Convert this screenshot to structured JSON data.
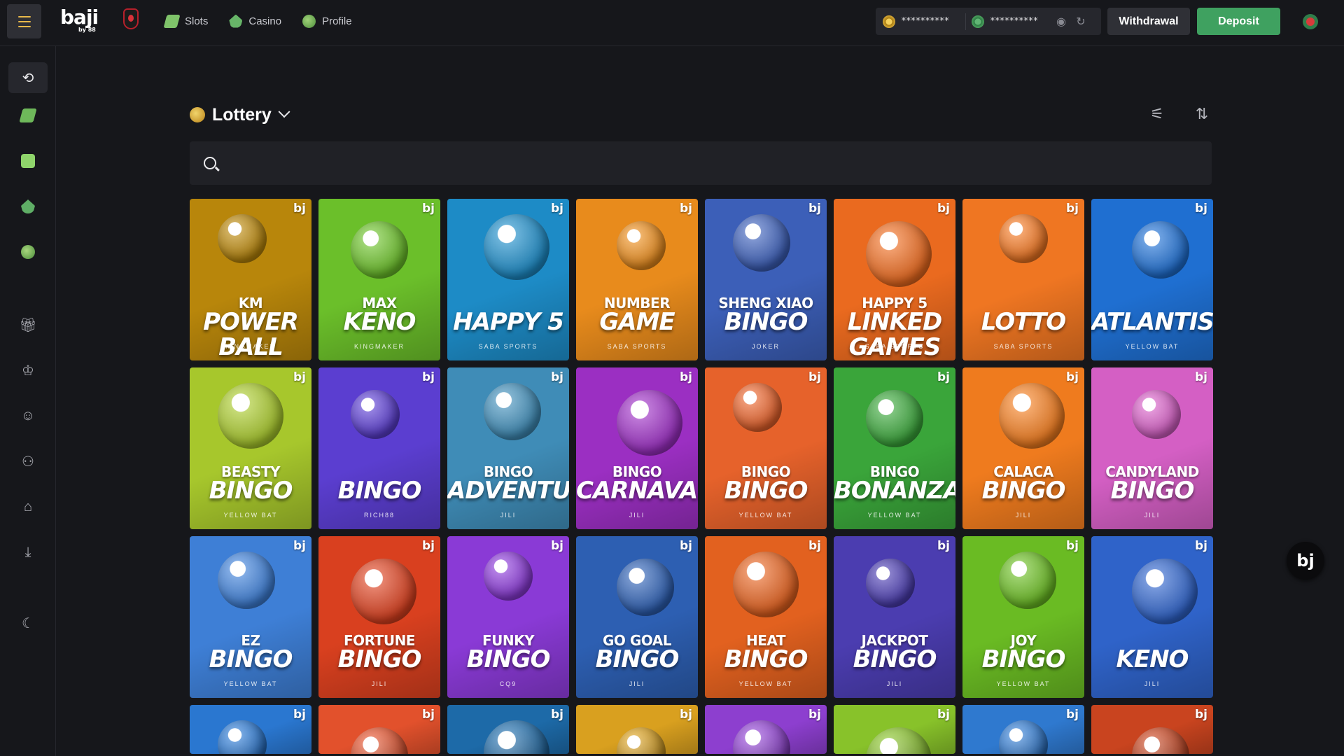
{
  "header": {
    "logo": "baji",
    "logo_sub": "by 88",
    "nav": [
      {
        "label": "Slots",
        "icon": "slots-icon"
      },
      {
        "label": "Casino",
        "icon": "casino-icon"
      },
      {
        "label": "Profile",
        "icon": "profile-icon"
      }
    ],
    "wallet": {
      "main_balance": "**********",
      "bonus_balance": "**********"
    },
    "withdraw_label": "Withdrawal",
    "deposit_label": "Deposit"
  },
  "sidebar": {
    "items": [
      "recent-icon",
      "slots-icon",
      "sports-icon",
      "casino-icon",
      "profile-icon",
      "gift-icon",
      "vip-crown-icon",
      "friends-icon",
      "affiliate-icon",
      "club-icon",
      "download-icon",
      "theme-moon-icon"
    ]
  },
  "category": {
    "title": "Lottery"
  },
  "search": {
    "placeholder": "",
    "value": ""
  },
  "games": [
    {
      "sub": "KM",
      "main": "POWER BALL",
      "provider": "KINGMAKER",
      "bg": "#b8860b"
    },
    {
      "sub": "MAX",
      "main": "KENO",
      "provider": "KINGMAKER",
      "bg": "#6bbf2a"
    },
    {
      "sub": "",
      "main": "HAPPY 5",
      "provider": "SABA SPORTS",
      "bg": "#1d8bc6"
    },
    {
      "sub": "NUMBER",
      "main": "GAME",
      "provider": "SABA SPORTS",
      "bg": "#e88b1c"
    },
    {
      "sub": "SHENG XIAO",
      "main": "BINGO",
      "provider": "JOKER",
      "bg": "#3c5fb8"
    },
    {
      "sub": "HAPPY 5",
      "main": "LINKED GAMES",
      "provider": "SABA SPORTS",
      "bg": "#ea6a1f"
    },
    {
      "sub": "",
      "main": "LOTTO",
      "provider": "SABA SPORTS",
      "bg": "#ef7622"
    },
    {
      "sub": "",
      "main": "ATLANTIS",
      "provider": "YELLOW BAT",
      "bg": "#1f6fd1"
    },
    {
      "sub": "BEASTY",
      "main": "BINGO",
      "provider": "YELLOW BAT",
      "bg": "#a7c72c"
    },
    {
      "sub": "",
      "main": "BINGO",
      "provider": "RICH88",
      "bg": "#5b3ed0"
    },
    {
      "sub": "BINGO",
      "main": "ADVENTURE",
      "provider": "JILI",
      "bg": "#3f8cb7"
    },
    {
      "sub": "BINGO",
      "main": "CARNAVAL",
      "provider": "JILI",
      "bg": "#9b2fc2"
    },
    {
      "sub": "BINGO",
      "main": "BINGO",
      "provider": "YELLOW BAT",
      "bg": "#e6622b"
    },
    {
      "sub": "BINGO",
      "main": "BONANZA",
      "provider": "YELLOW BAT",
      "bg": "#3aa53a"
    },
    {
      "sub": "CALACA",
      "main": "BINGO",
      "provider": "JILI",
      "bg": "#ef7b1e"
    },
    {
      "sub": "CANDYLAND",
      "main": "BINGO",
      "provider": "JILI",
      "bg": "#d45fc4"
    },
    {
      "sub": "EZ",
      "main": "BINGO",
      "provider": "YELLOW BAT",
      "bg": "#3e7fd6"
    },
    {
      "sub": "FORTUNE",
      "main": "BINGO",
      "provider": "JILI",
      "bg": "#d9401f"
    },
    {
      "sub": "FUNKY",
      "main": "BINGO",
      "provider": "CQ9",
      "bg": "#8a3ad6"
    },
    {
      "sub": "GO GOAL",
      "main": "BINGO",
      "provider": "JILI",
      "bg": "#2d5fb2"
    },
    {
      "sub": "HEAT",
      "main": "BINGO",
      "provider": "YELLOW BAT",
      "bg": "#e2611f"
    },
    {
      "sub": "JACKPOT",
      "main": "BINGO",
      "provider": "JILI",
      "bg": "#4b3db0"
    },
    {
      "sub": "JOY",
      "main": "BINGO",
      "provider": "YELLOW BAT",
      "bg": "#6abb23"
    },
    {
      "sub": "",
      "main": "KENO",
      "provider": "JILI",
      "bg": "#2f63c9"
    },
    {
      "sub": "",
      "main": "",
      "provider": "",
      "bg": "#2a77d0"
    },
    {
      "sub": "",
      "main": "",
      "provider": "",
      "bg": "#e2512c"
    },
    {
      "sub": "",
      "main": "",
      "provider": "",
      "bg": "#1d6aa8"
    },
    {
      "sub": "",
      "main": "",
      "provider": "",
      "bg": "#d9a01f"
    },
    {
      "sub": "",
      "main": "",
      "provider": "",
      "bg": "#8d3fcf"
    },
    {
      "sub": "",
      "main": "",
      "provider": "",
      "bg": "#88c22a"
    },
    {
      "sub": "",
      "main": "",
      "provider": "",
      "bg": "#2f79cf"
    },
    {
      "sub": "",
      "main": "",
      "provider": "",
      "bg": "#c9441f"
    }
  ],
  "chat": {
    "label": "bj"
  }
}
